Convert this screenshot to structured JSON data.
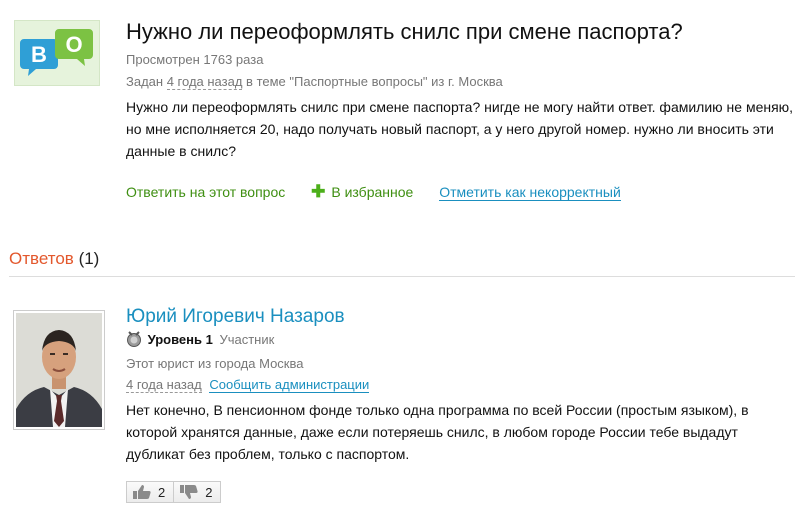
{
  "question": {
    "logo_icon": "chat-bubbles-logo-icon",
    "logo_letters": [
      "В",
      "О"
    ],
    "title": "Нужно ли переоформлять снилс при смене паспорта?",
    "views": "Просмотрен 1763 раза",
    "asked_prefix": "Задан",
    "asked_date": "4 года назад",
    "asked_suffix": "в теме \"Паспортные вопросы\" из г. Москва",
    "body": "Нужно ли переоформлять снилс при смене паспорта? нигде не могу найти ответ. фамилию не меняю, но мне исполняется 20, надо получать новый паспорт, а у него другой номер. нужно ли вносить эти данные в снилс?",
    "actions": {
      "answer": "Ответить на этот вопрос",
      "favorite": "В избранное",
      "report": "Отметить как некорректный"
    }
  },
  "answers": {
    "label": "Ответов",
    "count": "(1)"
  },
  "answer": {
    "author": "Юрий Игоревич Назаров",
    "level": "Уровень 1",
    "role": "Участник",
    "city": "Этот юрист из города Москва",
    "date": "4 года назад",
    "notify": "Сообщить администрации",
    "body": "Нет конечно, В пенсионном фонде только одна программа по всей России (простым языком), в которой хранятся данные, даже если потеряешь снилс, в любом городе России тебе выдадут дубликат без проблем, только с паспортом.",
    "votes_up": "2",
    "votes_down": "2"
  },
  "colors": {
    "link_green": "#3f8f12",
    "link_blue": "#1a8fbf",
    "accent_orange": "#e3582d"
  }
}
